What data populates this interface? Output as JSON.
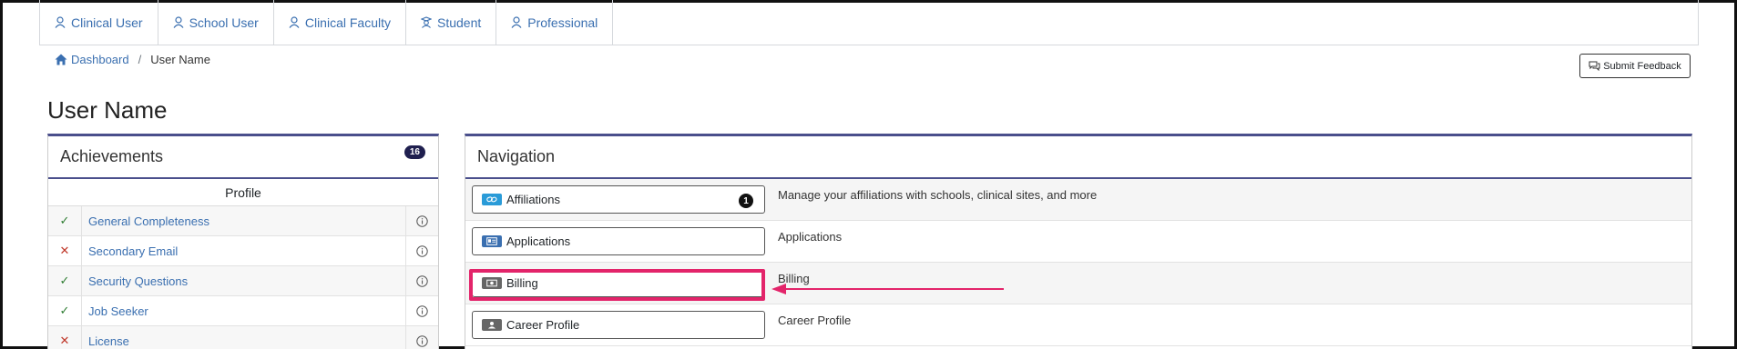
{
  "topnav": {
    "tabs": [
      {
        "label": "Clinical User",
        "icon": "user-icon"
      },
      {
        "label": "School User",
        "icon": "user-icon"
      },
      {
        "label": "Clinical Faculty",
        "icon": "user-icon"
      },
      {
        "label": "Student",
        "icon": "student-icon"
      },
      {
        "label": "Professional",
        "icon": "user-icon"
      }
    ]
  },
  "breadcrumb": {
    "home": "Dashboard",
    "separator": "/",
    "current": "User Name"
  },
  "feedback_label": "Submit Feedback",
  "page_title": "User Name",
  "achievements": {
    "title": "Achievements",
    "badge": "16",
    "subheading": "Profile",
    "items": [
      {
        "label": "General Completeness",
        "status": "✓",
        "kind": "ok"
      },
      {
        "label": "Secondary Email",
        "status": "✕",
        "kind": "bad"
      },
      {
        "label": "Security Questions",
        "status": "✓",
        "kind": "ok"
      },
      {
        "label": "Job Seeker",
        "status": "✓",
        "kind": "ok"
      },
      {
        "label": "License",
        "status": "✕",
        "kind": "bad"
      }
    ]
  },
  "navigation": {
    "title": "Navigation",
    "items": [
      {
        "label": "Affiliations",
        "description": "Manage your affiliations with schools, clinical sites, and more",
        "count": "1",
        "icon": "link-icon",
        "icon_color": "#2a9bd8"
      },
      {
        "label": "Applications",
        "description": "Applications",
        "icon": "id-card-icon",
        "icon_color": "#3a6fb0"
      },
      {
        "label": "Billing",
        "description": "Billing",
        "icon": "money-icon",
        "icon_color": "#666666"
      },
      {
        "label": "Career Profile",
        "description": "Career Profile",
        "icon": "person-card-icon",
        "icon_color": "#666666"
      }
    ]
  },
  "colors": {
    "link": "#3a6fb0",
    "panel_accent": "#4a4f8c",
    "highlight": "#e3246a"
  }
}
